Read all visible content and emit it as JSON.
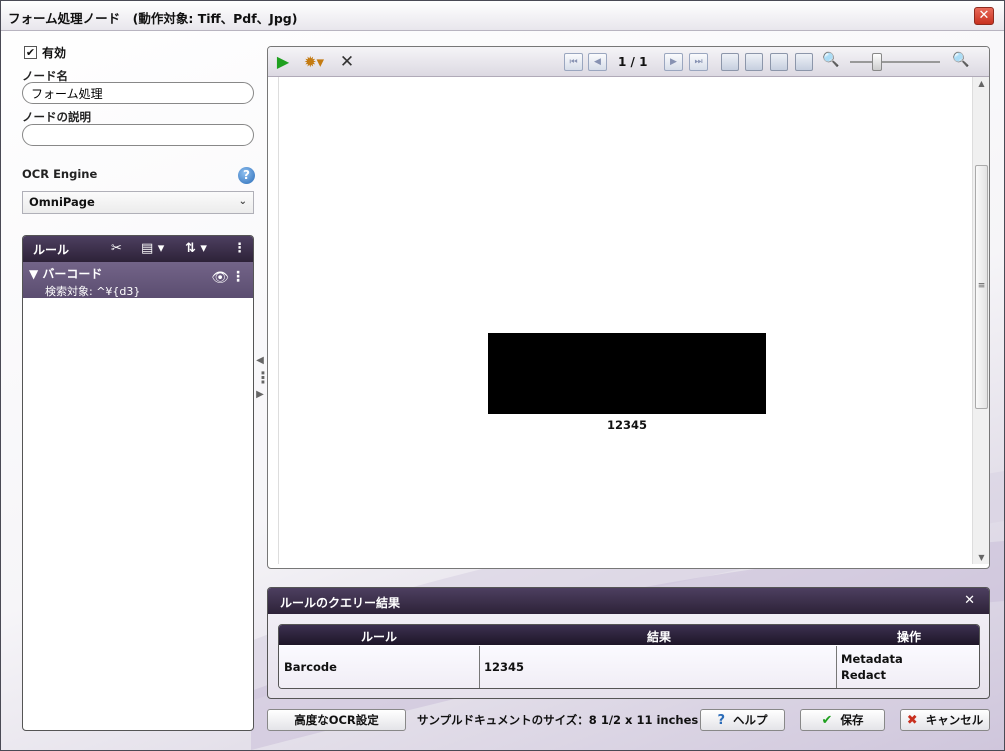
{
  "window": {
    "title": "フォーム処理ノード　(動作対象: Tiff、Pdf、Jpg)",
    "close_glyph": "✕"
  },
  "left": {
    "enabled_label": "有効",
    "enabled_checked": true,
    "check_glyph": "✔",
    "node_name_label": "ノード名",
    "node_name_value": "フォーム処理",
    "node_desc_label": "ノードの説明",
    "node_desc_value": "",
    "ocr_label": "OCR Engine",
    "help_glyph": "?",
    "ocr_selected": "OmniPage",
    "select_caret": "⌄"
  },
  "rules": {
    "header": "ルール",
    "items": [
      {
        "expander": "▼",
        "name": "バーコード",
        "subtitle": "検索対象: ^¥{d3}"
      }
    ],
    "eye_glyph": "👁",
    "menu_glyph": "⋮",
    "icons": {
      "clear": "✂",
      "add": "▤ ▾",
      "copy": "⇅ ▾",
      "menu": "⋮"
    }
  },
  "splitter": {
    "left_arrow": "◀",
    "dots": "⋮",
    "right_arrow": "▶"
  },
  "viewer": {
    "toolbar": {
      "play_glyph": "▶",
      "gear_glyph": "✹▾",
      "close_glyph": "✕",
      "nav": {
        "first": "⏮",
        "prev": "◀",
        "next": "▶",
        "last": "⏭"
      },
      "page_indicator": "1 / 1",
      "zoom_out_glyph": "🔍",
      "zoom_in_glyph": "🔍"
    },
    "barcode_value": "12345",
    "zoom_level_fraction": 0.3,
    "scroll": {
      "up": "▲",
      "down": "▼",
      "grip": "≡"
    }
  },
  "results": {
    "title": "ルールのクエリー結果",
    "close_glyph": "✕",
    "columns": [
      "ルール",
      "結果",
      "操作"
    ],
    "rows": [
      {
        "rule": "Barcode",
        "result": "12345",
        "ops": [
          "Metadata",
          "Redact"
        ]
      }
    ]
  },
  "footer": {
    "advanced_button": "高度なOCR設定",
    "sample_size": "サンプルドキュメントのサイズ：8 1/2 x 11 inches",
    "help_button": "ヘルプ",
    "save_button": "保存",
    "cancel_button": "キャンセル",
    "help_icon": "?",
    "save_icon": "✔",
    "cancel_icon": "✖"
  },
  "colors": {
    "header_purple": "#2d2238",
    "rule_item_purple": "#5b4d70",
    "play_green": "#1fa01f",
    "cancel_red": "#c8301f"
  }
}
